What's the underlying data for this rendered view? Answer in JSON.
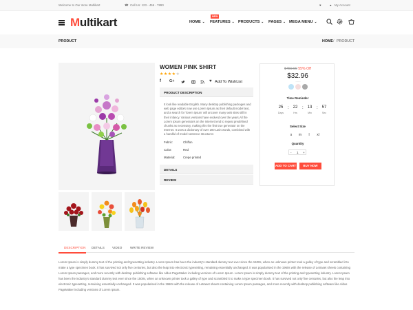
{
  "topbar": {
    "welcome": "Welcome to Our store Multikart",
    "phone": "Call Us: 123 - 456 - 7890",
    "account": "My Account"
  },
  "logo": {
    "m": "M",
    "rest": "ultikart"
  },
  "nav": {
    "items": [
      {
        "label": "HOME"
      },
      {
        "label": "FEATURES",
        "badge": "NEW"
      },
      {
        "label": "PRODUCTS"
      },
      {
        "label": "PAGES"
      },
      {
        "label": "MEGA MENU"
      }
    ]
  },
  "breadcrumb": {
    "title": "PRODUCT",
    "home": "HOME",
    "sep": "/",
    "current": "PRODUCT"
  },
  "product": {
    "name": "WOMEN PINK SHIRT",
    "rating": 4,
    "stars_on": "★★★★",
    "stars_off": "★",
    "wishlist": "Add To WishList",
    "sections": {
      "description": "PRODUCT DESCRIPTION",
      "details": "DETAILS",
      "review": "REVIEW"
    },
    "description": "It look like readable English. Many desktop publishing packages and web page editors now use Lorem Ipsum as their default model text, and a search for 'lorem ipsum' will uncover many web sites still in their infancy. Various versions have evolved over the years,All the Lorem Ipsum generators on the Internet tend to repeat predefined chunks as necessary, making this the first true generator on the Internet. It uses a dictionary of over 200 Latin words, combined with a handful of model sentence structures",
    "specs": [
      {
        "k": "Febric:",
        "v": "Chiffon"
      },
      {
        "k": "Color:",
        "v": "Red"
      },
      {
        "k": "Material:",
        "v": "Crepe printed"
      }
    ]
  },
  "panel": {
    "old_price": "$459.00",
    "discount": "55% Off",
    "price": "$32.96",
    "swatches": [
      "#bfe3f7",
      "#f5dede",
      "#a9a9a9"
    ],
    "time_label": "Time Reminder",
    "timer": [
      {
        "n": "25",
        "u": "Days"
      },
      {
        "n": "22",
        "u": "Hrs"
      },
      {
        "n": "13",
        "u": "Min"
      },
      {
        "n": "57",
        "u": "Sec"
      }
    ],
    "size_label": "Select Size",
    "sizes": [
      "s",
      "m",
      "l",
      "xl"
    ],
    "qty_label": "Quantity",
    "qty": "1",
    "minus": "-",
    "plus": "+",
    "add_to_cart": "ADD TO CART",
    "buy_now": "BUY NOW"
  },
  "tabs": [
    "DESCRIPTION",
    "DETAILS",
    "VIDEO",
    "WRITE REVIEW"
  ],
  "tab_body": "Lorem Ipsum is simply dummy text of the printing and typesetting industry. Lorem Ipsum has been the industry's standard dummy text ever since the 1500s, when an unknown printer took a galley of type and scrambled it to make a type specimen book. It has survived not only five centuries, but also the leap into electronic typesetting, remaining essentially unchanged. It was popularised in the 1960s with the release of Letraset sheets containing Lorem Ipsum passages, and more recently with desktop publishing software like Aldus PageMaker including versions of Lorem Ipsum. Lorem Ipsum is simply dummy text of the printing and typesetting industry. Lorem Ipsum has been the industry's standard dummy text ever since the 1500s, when an unknown printer took a galley of type and scrambled it to make a type specimen book. It has survived not only five centuries, but also the leap into electronic typesetting, remaining essentially unchanged. It was popularised in the 1960s with the release of Letraset sheets containing Lorem Ipsum passages, and more recently with desktop publishing software like Aldus PageMaker including versions of Lorem Ipsum.",
  "colors": {
    "accent": "#ff4c3b",
    "star": "#ffa200"
  }
}
